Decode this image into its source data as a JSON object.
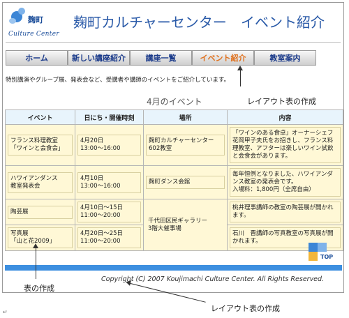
{
  "header": {
    "logo_jp": "麹町",
    "logo_en": "Culture Center",
    "site_title": "麹町カルチャーセンター",
    "page_heading": "イベント紹介"
  },
  "nav": {
    "items": [
      {
        "label": "ホーム",
        "active": false
      },
      {
        "label": "新しい講座紹介",
        "active": false
      },
      {
        "label": "講座一覧",
        "active": false
      },
      {
        "label": "イベント紹介",
        "active": true
      },
      {
        "label": "教室案内",
        "active": false
      }
    ]
  },
  "intro": "特別講演やグループ展、発表会など、受講者や講師のイベントをご紹介しています。",
  "month_title": "4月のイベント",
  "table": {
    "headers": [
      "イベント",
      "日にち・開催時刻",
      "場所",
      "内容"
    ],
    "rows": [
      {
        "event": "フランス料理教室\n「ワインと会食会」",
        "date": "4月20日\n13:00～16:00",
        "place": "麹町カルチャーセンター\n602教室",
        "content": "「ワインのある食卓」オーナーシェフ花岡甲子夫氏をお招きし、フランス料理教室、アフターは楽しいワイン試飲と会食会があります。"
      },
      {
        "event": "ハワイアンダンス\n教室発表会",
        "date": "4月10日\n13:00～16:00",
        "place": "麹町ダンス会館",
        "content": "毎年恒例となりました、ハワイアンダンス教室の発表会です。\n入場料：1,800円（全席自由）"
      },
      {
        "event": "陶芸展",
        "date": "4月10日～15日\n11:00～20:00",
        "place": "千代田区民ギャラリー\n3階大催事場",
        "content": "桃井理事講師の教室の陶芸展が開かれます。"
      },
      {
        "event": "写真展\n「山と花2009」",
        "date": "4月20日～25日\n11:00～20:00",
        "place": "",
        "content": "石川　晋講師の写真教室の写真展が開かれます。"
      }
    ]
  },
  "top_button": "TOP",
  "footer": {
    "copyright": "Copyright (C) 2007 Koujimachi Culture Center. All Rights Reserved."
  },
  "annotations": {
    "layout_top": "レイアウト表の作成",
    "table": "表の作成",
    "layout_bottom": "レイアウト表の作成"
  },
  "colors": {
    "title_blue": "#2a5aa8",
    "active_nav": "#e0701c",
    "table_bg": "#fff8d6",
    "header_bg": "#e8f4fc",
    "footer_bar": "#3d8fe0"
  }
}
